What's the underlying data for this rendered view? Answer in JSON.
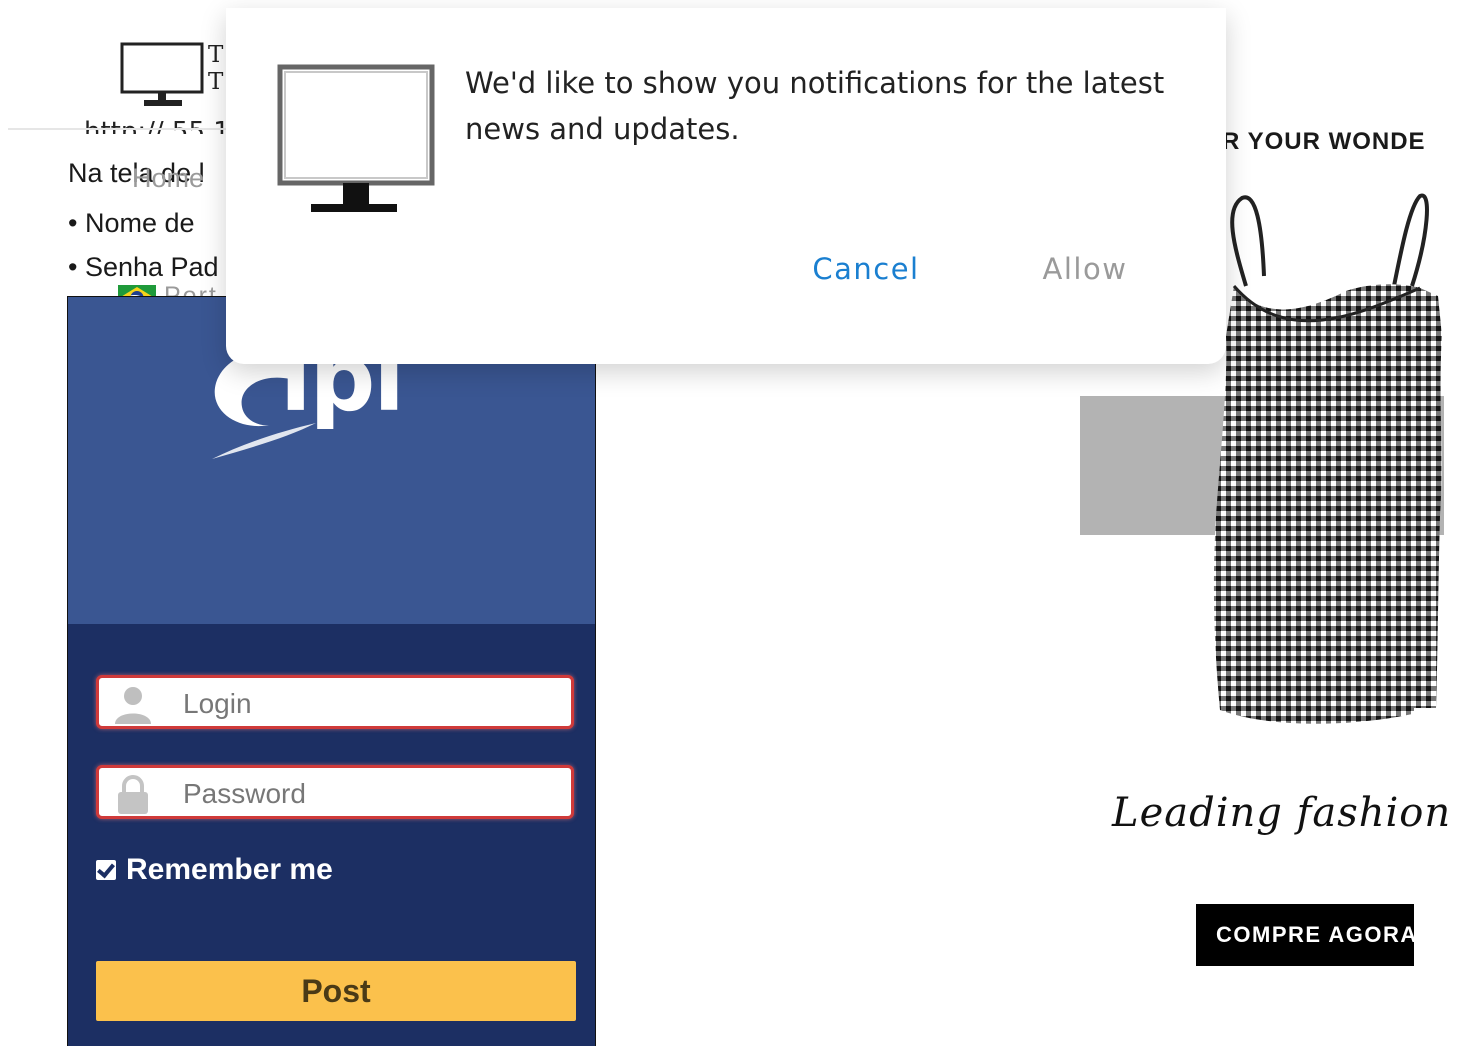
{
  "site": {
    "logo_letters": [
      "T",
      "T"
    ],
    "url_fragment": "http:// 55.1",
    "nav_home": "Home",
    "language": "Port",
    "content_lines": [
      "Na tela de l",
      "• Nome de",
      "• Senha Pad"
    ]
  },
  "glpi_screenshot": {
    "logo_text": "lpi",
    "login_placeholder": "Login",
    "password_placeholder": "Password",
    "remember_label": "Remember me",
    "submit_label": "Post"
  },
  "ad": {
    "tagline": "R YOUR WONDE",
    "script_text": "Leading fashion",
    "cta_label": "COMPRE AGORA"
  },
  "notification": {
    "message": "We'd like to show you notifications for the latest news and updates.",
    "cancel_label": "Cancel",
    "allow_label": "Allow"
  },
  "colors": {
    "cancel": "#1a7fd0",
    "allow_disabled": "#9a9a9a",
    "glpi_top": "#3a5692",
    "glpi_bottom": "#1c2f63",
    "post_button": "#fbc14c"
  }
}
